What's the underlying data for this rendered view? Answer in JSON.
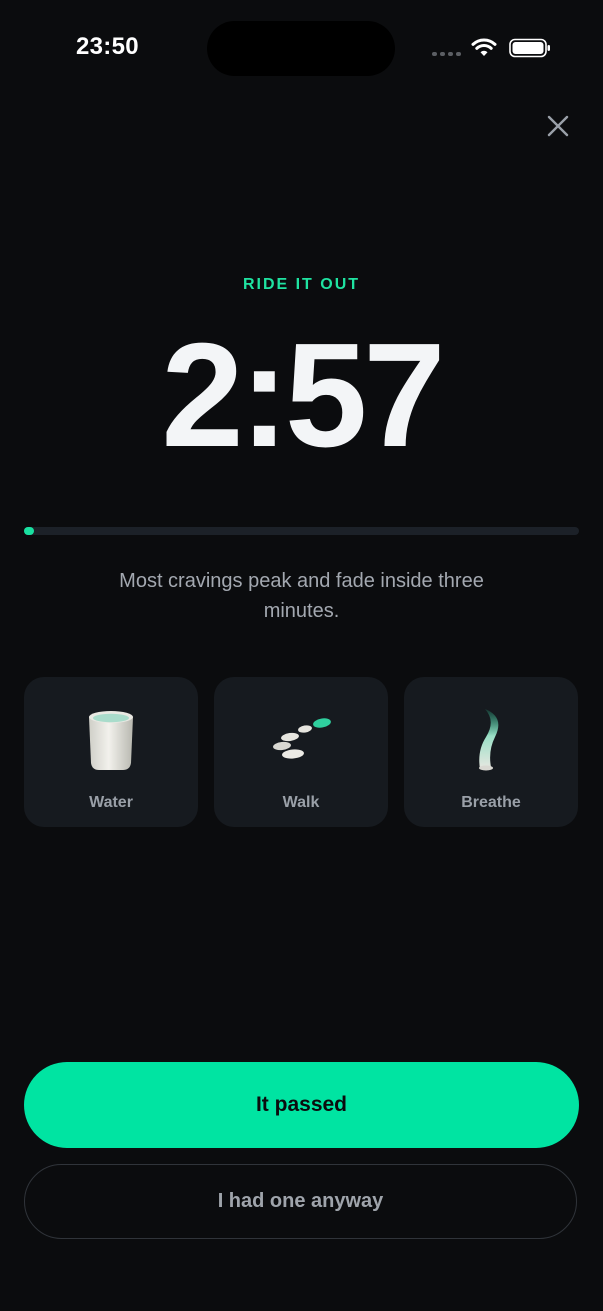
{
  "status_bar": {
    "time": "23:50",
    "icons": [
      "cellular-signal-icon",
      "wifi-icon",
      "battery-icon"
    ]
  },
  "close": {
    "icon": "close-icon"
  },
  "header": {
    "eyebrow": "RIDE IT OUT",
    "timer": "2:57"
  },
  "progress": {
    "fraction": 0.017
  },
  "caption": "Most cravings peak and fade inside three minutes.",
  "actions": [
    {
      "label": "Water",
      "icon": "water-cup-icon"
    },
    {
      "label": "Walk",
      "icon": "walk-stones-icon"
    },
    {
      "label": "Breathe",
      "icon": "breath-wisp-icon"
    }
  ],
  "buttons": {
    "primary": "It passed",
    "secondary": "I had one anyway"
  },
  "colors": {
    "background": "#0b0c0e",
    "accent": "#00e4a2",
    "card": "#161a1f",
    "muted_text": "#a3a8b0"
  }
}
